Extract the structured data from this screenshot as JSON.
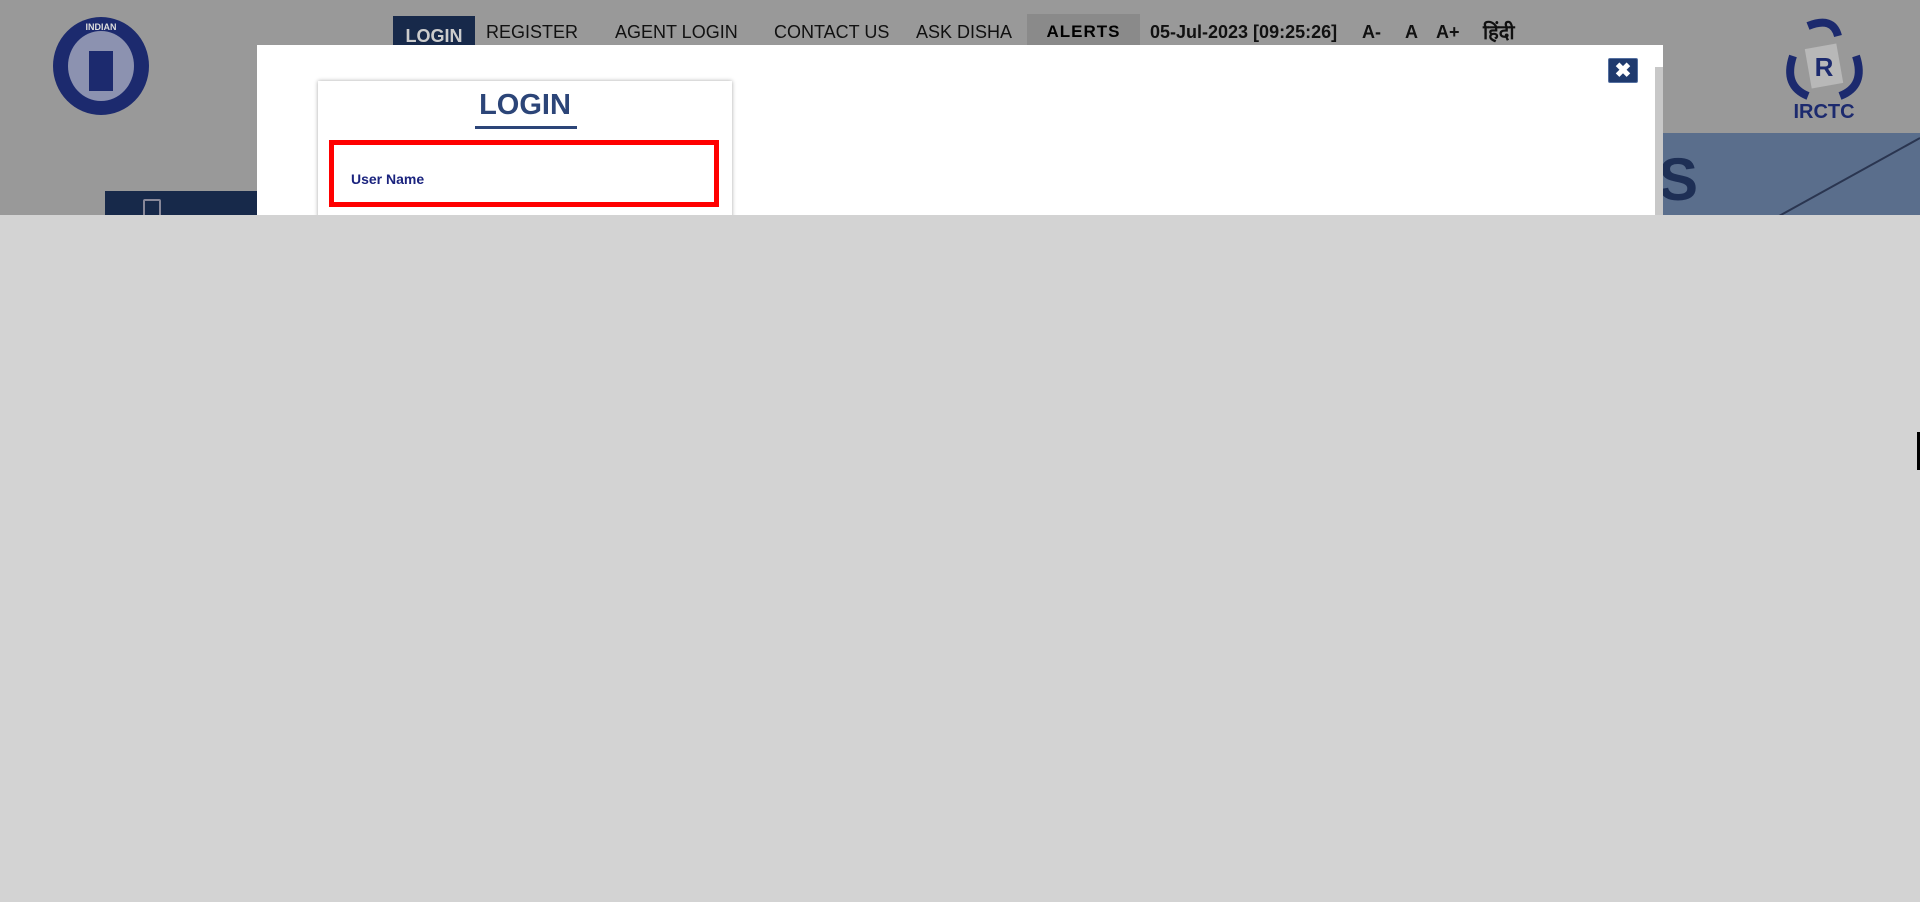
{
  "header": {
    "nav": [
      "LOGIN",
      "REGISTER",
      "AGENT LOGIN",
      "CONTACT US",
      "ASK DISHA",
      "ALERTS"
    ],
    "datetime": "05-Jul-2023 [09:25:26]",
    "font_controls": [
      "A-",
      "A",
      "A+"
    ],
    "language": "हिंदी",
    "left_logo": "INDIAN RAILWAYS",
    "right_logo": "IRCTC"
  },
  "banner": {
    "partial_text": "S"
  },
  "modal": {
    "close_icon": "close-icon",
    "title": "LOGIN",
    "username_label": "User Name"
  },
  "colors": {
    "accent": "#17294a",
    "highlight": "#ff0000",
    "overlay": "#999999"
  }
}
